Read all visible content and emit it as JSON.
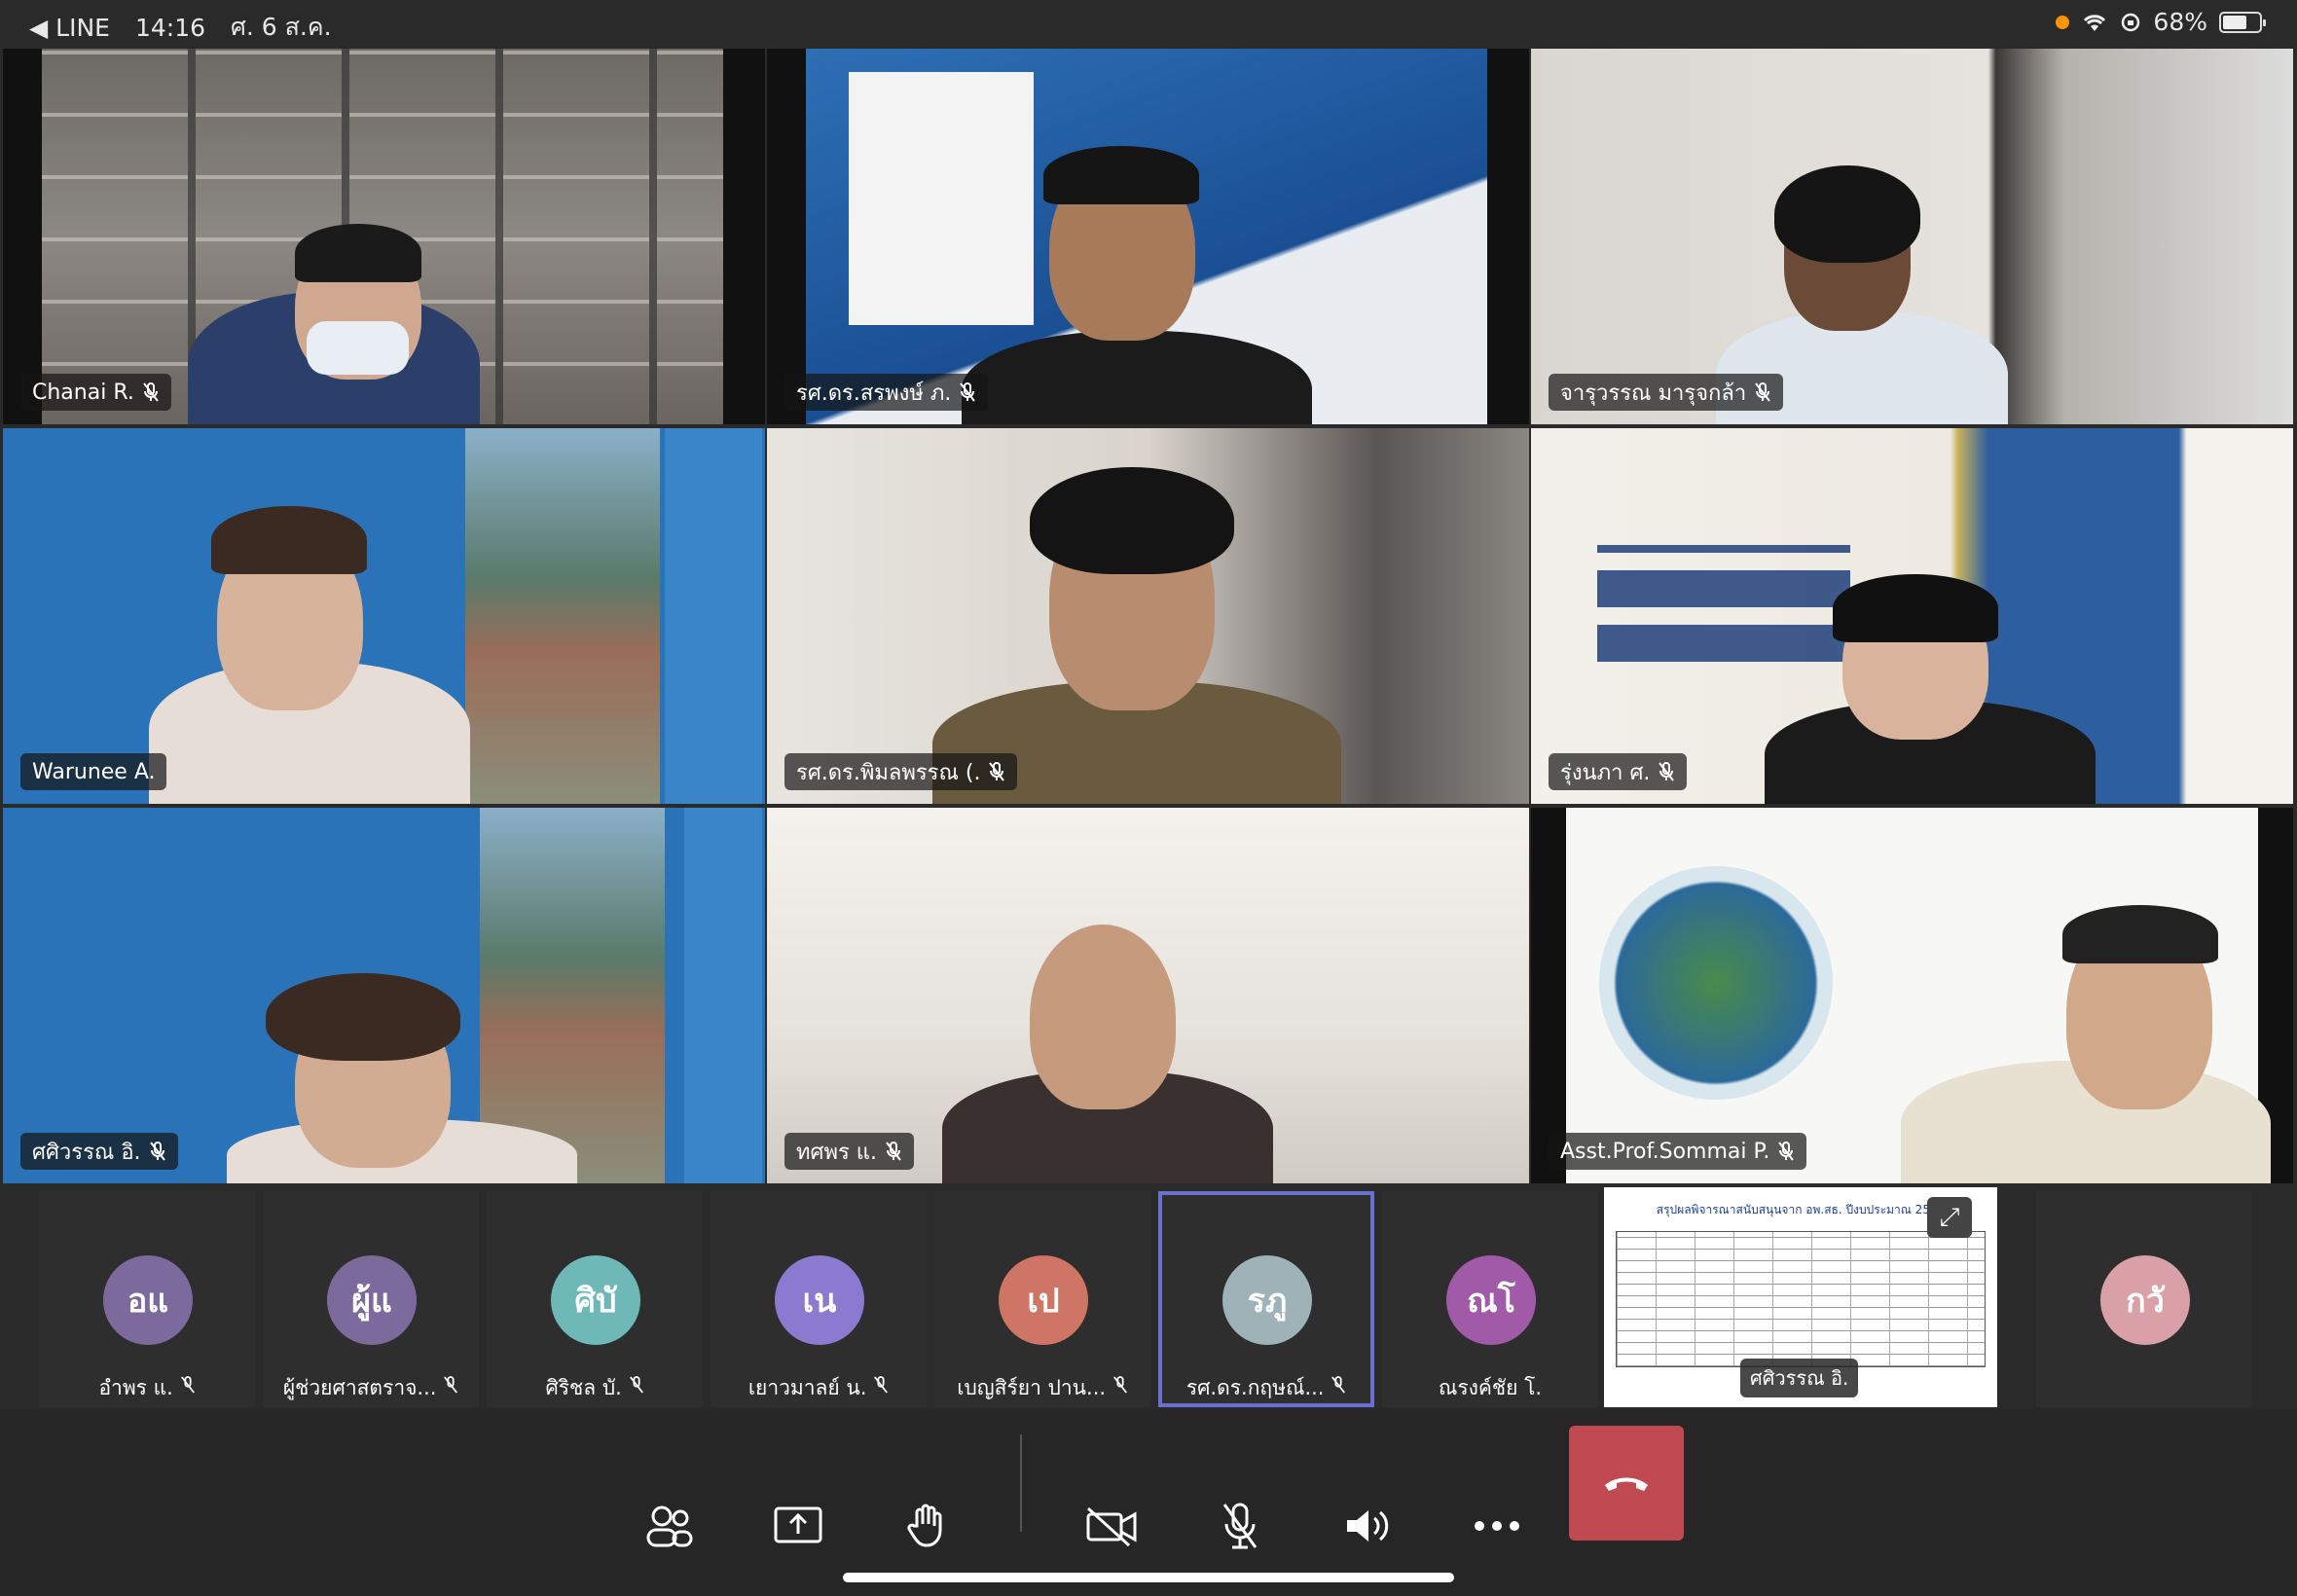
{
  "status_bar": {
    "back_label": "◀ LINE",
    "time": "14:16",
    "date": "ศ. 6 ส.ค.",
    "battery": "68%"
  },
  "video_grid": [
    {
      "name": "Chanai R."
    },
    {
      "name": "รศ.ดร.สรพงษ์ ภ."
    },
    {
      "name": "จารุวรรณ  มารุจกล้า"
    },
    {
      "name": "Warunee A."
    },
    {
      "name": "รศ.ดร.พิมลพรรณ (."
    },
    {
      "name": "รุ่งนภา ศ."
    },
    {
      "name": "ศศิวรรณ อิ."
    },
    {
      "name": "ทศพร แ."
    },
    {
      "name": "Asst.Prof.Sommai P."
    }
  ],
  "participants": [
    {
      "initials": "อแ",
      "name": "อำพร แ.",
      "color": "#7d6a9c"
    },
    {
      "initials": "ผู้แ",
      "name": "ผู้ช่วยศาสตราจ...",
      "color": "#7d6a9c"
    },
    {
      "initials": "ศิบั",
      "name": "ศิริชล บั.",
      "color": "#6fb8b8"
    },
    {
      "initials": "เน",
      "name": "เยาวมาลย์ น.",
      "color": "#8a7bd0"
    },
    {
      "initials": "เป",
      "name": "เบญสิร์ยา  ปาน...",
      "color": "#cf7566"
    },
    {
      "initials": "รภู",
      "name": "รศ.ดร.กฤษณ์...",
      "color": "#9fb2b8"
    },
    {
      "initials": "ณโ",
      "name": "ณรงค์ชัย โ.",
      "color": "#a05aa8"
    },
    {
      "initials": "กวั",
      "name": "",
      "color": "#d9a0a8"
    }
  ],
  "screen_share": {
    "title": "สรุปผลพิจารณาสนับสนุนจาก อพ.สธ. ปีงบประมาณ 2565",
    "presenter": "ศศิวรรณ อิ."
  },
  "colors": {
    "active_border": "#6b6fd0",
    "end_call": "#c14a52"
  }
}
